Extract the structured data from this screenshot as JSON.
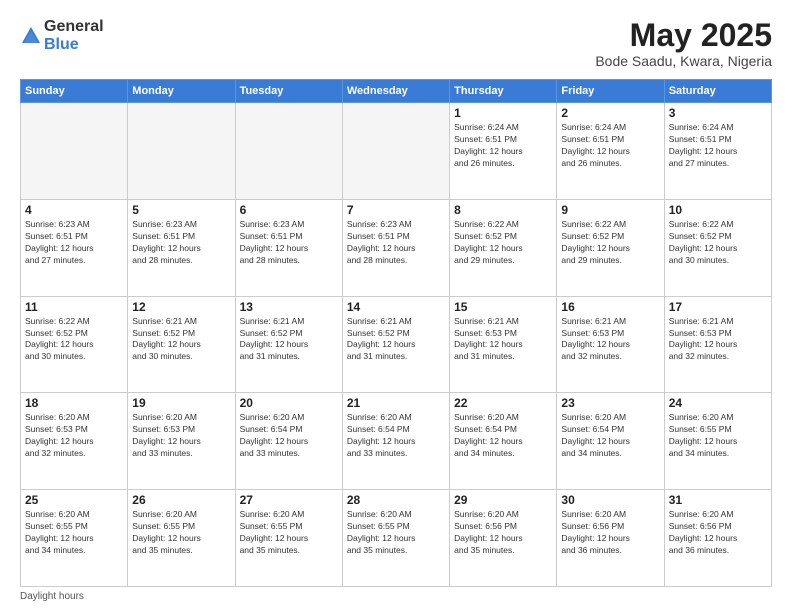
{
  "logo": {
    "general": "General",
    "blue": "Blue"
  },
  "header": {
    "month": "May 2025",
    "location": "Bode Saadu, Kwara, Nigeria"
  },
  "weekdays": [
    "Sunday",
    "Monday",
    "Tuesday",
    "Wednesday",
    "Thursday",
    "Friday",
    "Saturday"
  ],
  "weeks": [
    [
      {
        "day": "",
        "info": ""
      },
      {
        "day": "",
        "info": ""
      },
      {
        "day": "",
        "info": ""
      },
      {
        "day": "",
        "info": ""
      },
      {
        "day": "1",
        "info": "Sunrise: 6:24 AM\nSunset: 6:51 PM\nDaylight: 12 hours\nand 26 minutes."
      },
      {
        "day": "2",
        "info": "Sunrise: 6:24 AM\nSunset: 6:51 PM\nDaylight: 12 hours\nand 26 minutes."
      },
      {
        "day": "3",
        "info": "Sunrise: 6:24 AM\nSunset: 6:51 PM\nDaylight: 12 hours\nand 27 minutes."
      }
    ],
    [
      {
        "day": "4",
        "info": "Sunrise: 6:23 AM\nSunset: 6:51 PM\nDaylight: 12 hours\nand 27 minutes."
      },
      {
        "day": "5",
        "info": "Sunrise: 6:23 AM\nSunset: 6:51 PM\nDaylight: 12 hours\nand 28 minutes."
      },
      {
        "day": "6",
        "info": "Sunrise: 6:23 AM\nSunset: 6:51 PM\nDaylight: 12 hours\nand 28 minutes."
      },
      {
        "day": "7",
        "info": "Sunrise: 6:23 AM\nSunset: 6:51 PM\nDaylight: 12 hours\nand 28 minutes."
      },
      {
        "day": "8",
        "info": "Sunrise: 6:22 AM\nSunset: 6:52 PM\nDaylight: 12 hours\nand 29 minutes."
      },
      {
        "day": "9",
        "info": "Sunrise: 6:22 AM\nSunset: 6:52 PM\nDaylight: 12 hours\nand 29 minutes."
      },
      {
        "day": "10",
        "info": "Sunrise: 6:22 AM\nSunset: 6:52 PM\nDaylight: 12 hours\nand 30 minutes."
      }
    ],
    [
      {
        "day": "11",
        "info": "Sunrise: 6:22 AM\nSunset: 6:52 PM\nDaylight: 12 hours\nand 30 minutes."
      },
      {
        "day": "12",
        "info": "Sunrise: 6:21 AM\nSunset: 6:52 PM\nDaylight: 12 hours\nand 30 minutes."
      },
      {
        "day": "13",
        "info": "Sunrise: 6:21 AM\nSunset: 6:52 PM\nDaylight: 12 hours\nand 31 minutes."
      },
      {
        "day": "14",
        "info": "Sunrise: 6:21 AM\nSunset: 6:52 PM\nDaylight: 12 hours\nand 31 minutes."
      },
      {
        "day": "15",
        "info": "Sunrise: 6:21 AM\nSunset: 6:53 PM\nDaylight: 12 hours\nand 31 minutes."
      },
      {
        "day": "16",
        "info": "Sunrise: 6:21 AM\nSunset: 6:53 PM\nDaylight: 12 hours\nand 32 minutes."
      },
      {
        "day": "17",
        "info": "Sunrise: 6:21 AM\nSunset: 6:53 PM\nDaylight: 12 hours\nand 32 minutes."
      }
    ],
    [
      {
        "day": "18",
        "info": "Sunrise: 6:20 AM\nSunset: 6:53 PM\nDaylight: 12 hours\nand 32 minutes."
      },
      {
        "day": "19",
        "info": "Sunrise: 6:20 AM\nSunset: 6:53 PM\nDaylight: 12 hours\nand 33 minutes."
      },
      {
        "day": "20",
        "info": "Sunrise: 6:20 AM\nSunset: 6:54 PM\nDaylight: 12 hours\nand 33 minutes."
      },
      {
        "day": "21",
        "info": "Sunrise: 6:20 AM\nSunset: 6:54 PM\nDaylight: 12 hours\nand 33 minutes."
      },
      {
        "day": "22",
        "info": "Sunrise: 6:20 AM\nSunset: 6:54 PM\nDaylight: 12 hours\nand 34 minutes."
      },
      {
        "day": "23",
        "info": "Sunrise: 6:20 AM\nSunset: 6:54 PM\nDaylight: 12 hours\nand 34 minutes."
      },
      {
        "day": "24",
        "info": "Sunrise: 6:20 AM\nSunset: 6:55 PM\nDaylight: 12 hours\nand 34 minutes."
      }
    ],
    [
      {
        "day": "25",
        "info": "Sunrise: 6:20 AM\nSunset: 6:55 PM\nDaylight: 12 hours\nand 34 minutes."
      },
      {
        "day": "26",
        "info": "Sunrise: 6:20 AM\nSunset: 6:55 PM\nDaylight: 12 hours\nand 35 minutes."
      },
      {
        "day": "27",
        "info": "Sunrise: 6:20 AM\nSunset: 6:55 PM\nDaylight: 12 hours\nand 35 minutes."
      },
      {
        "day": "28",
        "info": "Sunrise: 6:20 AM\nSunset: 6:55 PM\nDaylight: 12 hours\nand 35 minutes."
      },
      {
        "day": "29",
        "info": "Sunrise: 6:20 AM\nSunset: 6:56 PM\nDaylight: 12 hours\nand 35 minutes."
      },
      {
        "day": "30",
        "info": "Sunrise: 6:20 AM\nSunset: 6:56 PM\nDaylight: 12 hours\nand 36 minutes."
      },
      {
        "day": "31",
        "info": "Sunrise: 6:20 AM\nSunset: 6:56 PM\nDaylight: 12 hours\nand 36 minutes."
      }
    ]
  ],
  "footer": {
    "note": "Daylight hours"
  }
}
